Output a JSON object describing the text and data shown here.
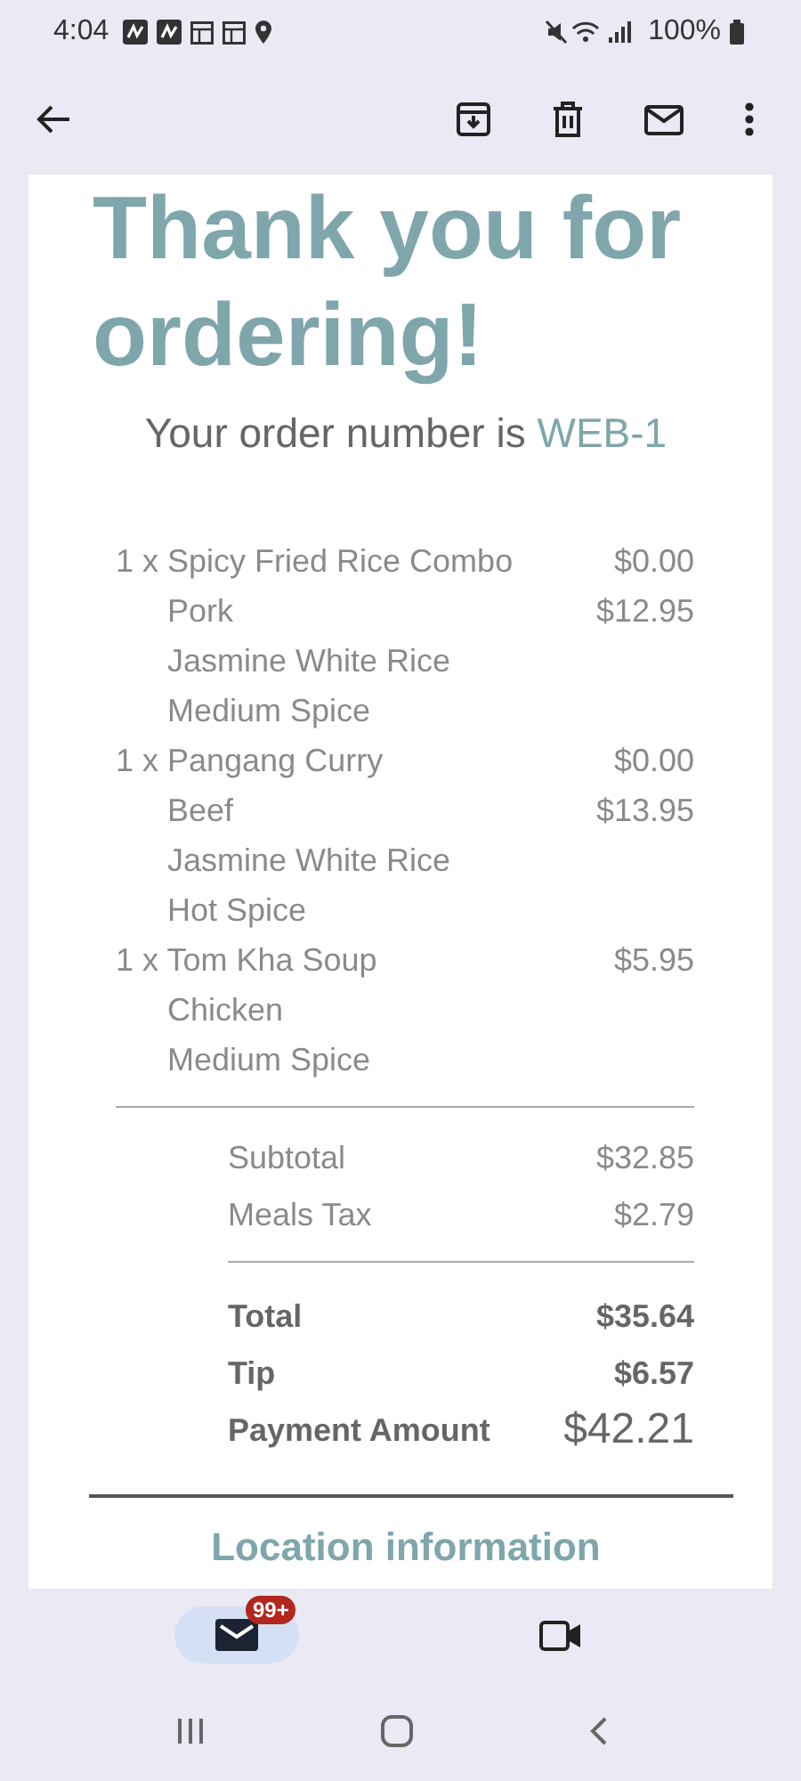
{
  "status_bar": {
    "time": "4:04",
    "battery": "100%"
  },
  "email": {
    "heading": "Thank you for ordering!",
    "order_label": "Your order number is",
    "order_number": "WEB-1",
    "items": [
      {
        "name": "1 x Spicy Fried Rice Combo",
        "price": "$0.00",
        "options": [
          {
            "name": "Pork",
            "price": "$12.95"
          },
          {
            "name": "Jasmine White Rice"
          },
          {
            "name": "Medium Spice"
          }
        ]
      },
      {
        "name": "1 x Pangang Curry",
        "price": "$0.00",
        "options": [
          {
            "name": "Beef",
            "price": "$13.95"
          },
          {
            "name": "Jasmine White Rice"
          },
          {
            "name": "Hot Spice"
          }
        ]
      },
      {
        "name": "1 x Tom Kha Soup",
        "price": "$5.95",
        "options": [
          {
            "name": "Chicken"
          },
          {
            "name": "Medium Spice"
          }
        ]
      }
    ],
    "subtotals": [
      {
        "label": "Subtotal",
        "value": "$32.85"
      },
      {
        "label": "Meals Tax",
        "value": "$2.79"
      }
    ],
    "totals": [
      {
        "label": "Total",
        "value": "$35.64",
        "kind": "normal"
      },
      {
        "label": "Tip",
        "value": "$6.57",
        "kind": "normal"
      },
      {
        "label": "Payment Amount",
        "value": "$42.21",
        "kind": "grand"
      }
    ],
    "section_heading": "Location information"
  },
  "bottom_nav": [
    {
      "kind": "mail",
      "selected": true,
      "badge": "99+"
    },
    {
      "kind": "video",
      "selected": false
    }
  ]
}
